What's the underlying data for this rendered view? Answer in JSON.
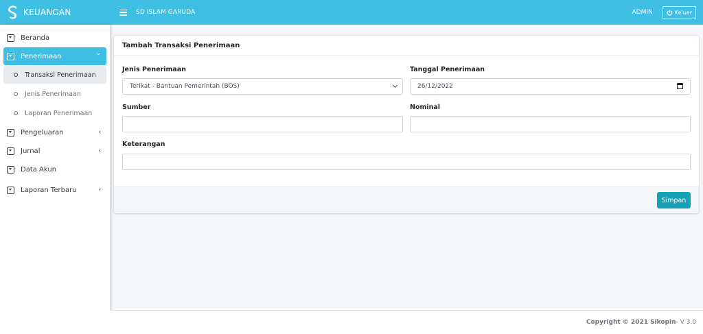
{
  "brand": {
    "name": "KEUANGAN",
    "logo_icon": "s-logo-icon"
  },
  "header": {
    "school": "SD ISLAM GARUDA",
    "user": "ADMIN",
    "logout_label": "Keluar"
  },
  "sidebar": {
    "items": [
      {
        "label": "Beranda"
      },
      {
        "label": "Penerimaan",
        "active": true,
        "sub": [
          {
            "label": "Transaksi Penerimaan",
            "current": true
          },
          {
            "label": "Jenis Penerimaan"
          },
          {
            "label": "Laporan Penerimaan"
          }
        ]
      },
      {
        "label": "Pengeluaran",
        "chevron": "‹"
      },
      {
        "label": "Jurnal",
        "chevron": "‹"
      },
      {
        "label": "Data Akun"
      },
      {
        "label": "Laporan Terbaru",
        "chevron": "‹"
      }
    ],
    "active_chevron": "⌄"
  },
  "form": {
    "title": "Tambah Transaksi Penerimaan",
    "jenis": {
      "label": "Jenis Penerimaan",
      "value": "Terikat - Bantuan Pemerintah (BOS)"
    },
    "tanggal": {
      "label": "Tanggal Penerimaan",
      "value": "26/12/2022"
    },
    "sumber": {
      "label": "Sumber",
      "value": ""
    },
    "nominal": {
      "label": "Nominal",
      "value": ""
    },
    "keterangan": {
      "label": "Keterangan",
      "value": ""
    },
    "save_label": "Simpan"
  },
  "footer": {
    "copyright": "Copyright © 2021 Sikopin",
    "version": " - V 3.0"
  },
  "colors": {
    "accent": "#3fbfe4",
    "button": "#17a2b8"
  }
}
